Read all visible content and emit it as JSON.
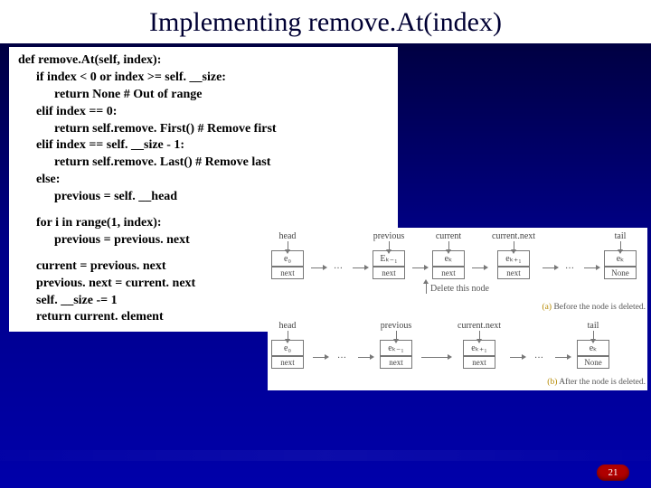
{
  "title": "Implementing remove.At(index)",
  "code": {
    "l1": "def remove.At(self, index):",
    "l2": "if index < 0 or index >= self. __size:",
    "l3": "return None # Out of range",
    "l4": "elif index == 0:",
    "l5": "return self.remove. First() # Remove first",
    "l6": "elif index == self. __size - 1:",
    "l7": "return self.remove. Last() # Remove last",
    "l8": "else:",
    "l9": "previous = self. __head",
    "l10": "for i in range(1, index):",
    "l11": "previous = previous. next",
    "l12": "current = previous. next",
    "l13": "previous. next = current. next",
    "l14": "self. __size -= 1",
    "l15": "return current. element"
  },
  "diagA": {
    "labels": {
      "head": "head",
      "prev": "previous",
      "curr": "current",
      "cnext": "current.next",
      "tail": "tail"
    },
    "nodes": {
      "e0": "e₀",
      "ekm1": "Eₖ₋₁",
      "ek": "eₖ",
      "ekp1": "eₖ₊₁",
      "eK": "eₖ"
    },
    "next": "next",
    "none": "None",
    "delete": "Delete this node",
    "caption": "Before the node is deleted.",
    "tag": "(a)"
  },
  "diagB": {
    "labels": {
      "head": "head",
      "prev": "previous",
      "cnext": "current.next",
      "tail": "tail"
    },
    "nodes": {
      "e0": "e₀",
      "ekm1": "eₖ₋₁",
      "ekp1": "eₖ₊₁",
      "eK": "eₖ"
    },
    "next": "next",
    "none": "None",
    "caption": "After the node is deleted.",
    "tag": "(b)"
  },
  "page": "21"
}
